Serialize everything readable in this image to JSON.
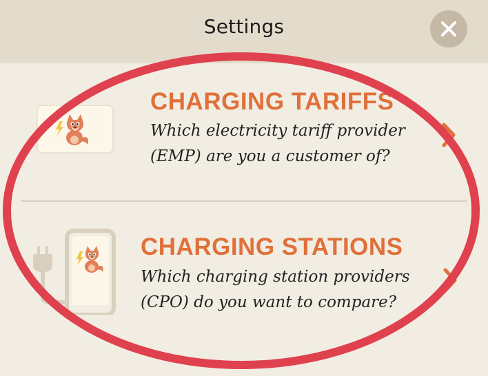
{
  "header": {
    "title": "Settings",
    "close_icon": "close-icon"
  },
  "rows": [
    {
      "title": "CHARGING TARIFFS",
      "desc_line1": "Which electricity tariff provider",
      "desc_line2": "(EMP) are you a customer of?",
      "icon": "fox-card-icon"
    },
    {
      "title": "CHARGING STATIONS",
      "desc_line1": "Which charging station providers",
      "desc_line2": "(CPO) do you want to compare?",
      "icon": "charging-station-icon"
    }
  ],
  "colors": {
    "accent": "#e0703a",
    "background": "#f2ede3",
    "header_bg": "#e3dccd",
    "annotation": "#e0414e"
  }
}
